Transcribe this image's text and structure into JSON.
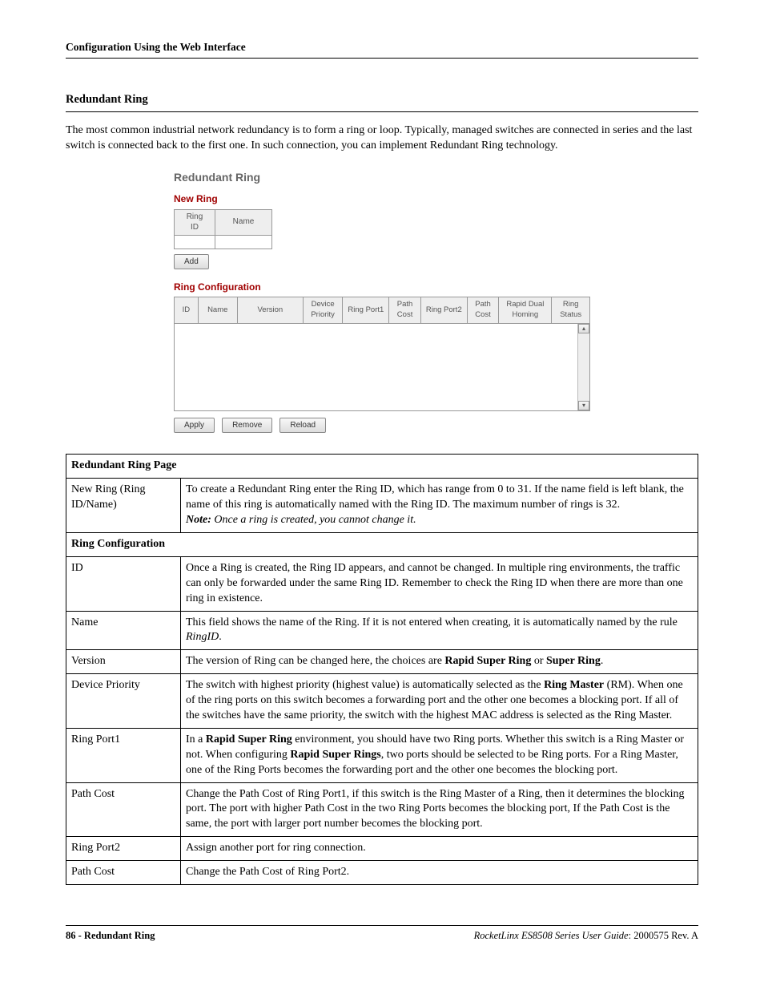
{
  "header": "Configuration Using the Web Interface",
  "sectionTitle": "Redundant Ring",
  "intro": "The most common industrial network redundancy is to form a ring or loop. Typically, managed switches are connected in series and the last switch is connected back to the first one. In such connection, you can implement Redundant Ring technology.",
  "mock": {
    "title": "Redundant Ring",
    "newRing": {
      "heading": "New Ring",
      "cols": [
        "Ring ID",
        "Name"
      ],
      "addBtn": "Add"
    },
    "ringCfg": {
      "heading": "Ring Configuration",
      "cols": [
        "ID",
        "Name",
        "Version",
        "Device Priority",
        "Ring Port1",
        "Path Cost",
        "Ring Port2",
        "Path Cost",
        "Rapid Dual Homing",
        "Ring Status"
      ],
      "buttons": [
        "Apply",
        "Remove",
        "Reload"
      ]
    }
  },
  "table": {
    "pageHeading": "Redundant Ring Page",
    "rows1": [
      {
        "label": "New Ring (Ring ID/Name)",
        "descMain": "To create a Redundant Ring enter the Ring ID, which has range from 0 to 31. If the name field is left blank, the name of this ring is automatically named with the Ring ID. The maximum number of rings is 32.",
        "noteLabel": "Note:",
        "noteText": "Once a ring is created, you cannot change it."
      }
    ],
    "subHeading": "Ring Configuration",
    "rows2": [
      {
        "label": "ID",
        "desc": "Once a Ring is created, the Ring ID appears, and cannot be changed. In multiple ring environments, the traffic can only be forwarded under the same Ring ID. Remember to check the Ring ID when there are more than one ring in existence."
      },
      {
        "label": "Name",
        "descPre": "This field shows the name of the Ring. If it is not entered when creating, it is automatically named by the rule ",
        "descEm": "RingID",
        "descPost": "."
      },
      {
        "label": "Version",
        "descPre": "The version of Ring can be changed here, the choices are ",
        "bold1": "Rapid Super Ring",
        "mid": " or ",
        "bold2": "Super Ring",
        "descPost": "."
      },
      {
        "label": "Device Priority",
        "descPre": "The switch with highest priority (highest value) is automatically selected as the ",
        "bold1": "Ring Master",
        "descPost": " (RM). When one of the ring ports on this switch becomes a forwarding port and the other one becomes a blocking port. If all of the switches have the same priority, the switch with the highest MAC address is selected as the Ring Master."
      },
      {
        "label": "Ring Port1",
        "descPre": "In a ",
        "bold1": "Rapid Super Ring",
        "mid": " environment, you should have two Ring ports. Whether this switch is a Ring Master or not. When configuring ",
        "bold2": "Rapid Super Rings",
        "descPost": ", two ports should be selected to be Ring ports. For a Ring Master, one of the Ring Ports becomes the forwarding port and the other one becomes the blocking port."
      },
      {
        "label": "Path Cost",
        "desc": "Change the Path Cost of Ring Port1, if this switch is the Ring Master of a Ring, then it determines the blocking port. The port with higher Path Cost in the two Ring Ports becomes the blocking port, If the Path Cost is the same, the port with larger port number becomes the blocking port."
      },
      {
        "label": "Ring Port2",
        "desc": "Assign another port for ring connection."
      },
      {
        "label": "Path Cost",
        "desc": "Change the Path Cost of Ring Port2."
      }
    ]
  },
  "footer": {
    "leftPage": "86 - Redundant Ring",
    "rightEm": "RocketLinx ES8508 Series  User Guide",
    "rightRest": ": 2000575 Rev. A"
  }
}
